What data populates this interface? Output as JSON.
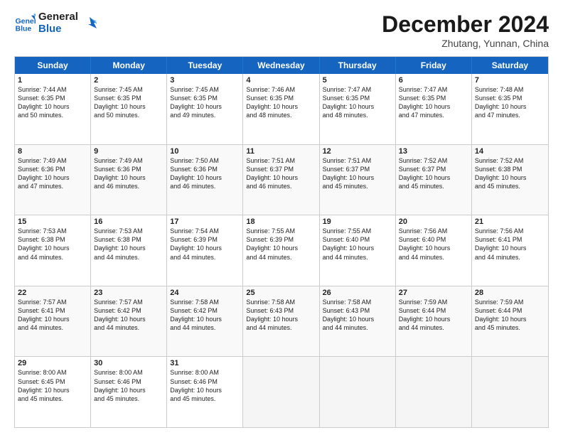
{
  "header": {
    "logo_line1": "General",
    "logo_line2": "Blue",
    "month": "December 2024",
    "location": "Zhutang, Yunnan, China"
  },
  "weekdays": [
    "Sunday",
    "Monday",
    "Tuesday",
    "Wednesday",
    "Thursday",
    "Friday",
    "Saturday"
  ],
  "rows": [
    [
      {
        "day": "1",
        "lines": [
          "Sunrise: 7:44 AM",
          "Sunset: 6:35 PM",
          "Daylight: 10 hours",
          "and 50 minutes."
        ]
      },
      {
        "day": "2",
        "lines": [
          "Sunrise: 7:45 AM",
          "Sunset: 6:35 PM",
          "Daylight: 10 hours",
          "and 50 minutes."
        ]
      },
      {
        "day": "3",
        "lines": [
          "Sunrise: 7:45 AM",
          "Sunset: 6:35 PM",
          "Daylight: 10 hours",
          "and 49 minutes."
        ]
      },
      {
        "day": "4",
        "lines": [
          "Sunrise: 7:46 AM",
          "Sunset: 6:35 PM",
          "Daylight: 10 hours",
          "and 48 minutes."
        ]
      },
      {
        "day": "5",
        "lines": [
          "Sunrise: 7:47 AM",
          "Sunset: 6:35 PM",
          "Daylight: 10 hours",
          "and 48 minutes."
        ]
      },
      {
        "day": "6",
        "lines": [
          "Sunrise: 7:47 AM",
          "Sunset: 6:35 PM",
          "Daylight: 10 hours",
          "and 47 minutes."
        ]
      },
      {
        "day": "7",
        "lines": [
          "Sunrise: 7:48 AM",
          "Sunset: 6:35 PM",
          "Daylight: 10 hours",
          "and 47 minutes."
        ]
      }
    ],
    [
      {
        "day": "8",
        "lines": [
          "Sunrise: 7:49 AM",
          "Sunset: 6:36 PM",
          "Daylight: 10 hours",
          "and 47 minutes."
        ]
      },
      {
        "day": "9",
        "lines": [
          "Sunrise: 7:49 AM",
          "Sunset: 6:36 PM",
          "Daylight: 10 hours",
          "and 46 minutes."
        ]
      },
      {
        "day": "10",
        "lines": [
          "Sunrise: 7:50 AM",
          "Sunset: 6:36 PM",
          "Daylight: 10 hours",
          "and 46 minutes."
        ]
      },
      {
        "day": "11",
        "lines": [
          "Sunrise: 7:51 AM",
          "Sunset: 6:37 PM",
          "Daylight: 10 hours",
          "and 46 minutes."
        ]
      },
      {
        "day": "12",
        "lines": [
          "Sunrise: 7:51 AM",
          "Sunset: 6:37 PM",
          "Daylight: 10 hours",
          "and 45 minutes."
        ]
      },
      {
        "day": "13",
        "lines": [
          "Sunrise: 7:52 AM",
          "Sunset: 6:37 PM",
          "Daylight: 10 hours",
          "and 45 minutes."
        ]
      },
      {
        "day": "14",
        "lines": [
          "Sunrise: 7:52 AM",
          "Sunset: 6:38 PM",
          "Daylight: 10 hours",
          "and 45 minutes."
        ]
      }
    ],
    [
      {
        "day": "15",
        "lines": [
          "Sunrise: 7:53 AM",
          "Sunset: 6:38 PM",
          "Daylight: 10 hours",
          "and 44 minutes."
        ]
      },
      {
        "day": "16",
        "lines": [
          "Sunrise: 7:53 AM",
          "Sunset: 6:38 PM",
          "Daylight: 10 hours",
          "and 44 minutes."
        ]
      },
      {
        "day": "17",
        "lines": [
          "Sunrise: 7:54 AM",
          "Sunset: 6:39 PM",
          "Daylight: 10 hours",
          "and 44 minutes."
        ]
      },
      {
        "day": "18",
        "lines": [
          "Sunrise: 7:55 AM",
          "Sunset: 6:39 PM",
          "Daylight: 10 hours",
          "and 44 minutes."
        ]
      },
      {
        "day": "19",
        "lines": [
          "Sunrise: 7:55 AM",
          "Sunset: 6:40 PM",
          "Daylight: 10 hours",
          "and 44 minutes."
        ]
      },
      {
        "day": "20",
        "lines": [
          "Sunrise: 7:56 AM",
          "Sunset: 6:40 PM",
          "Daylight: 10 hours",
          "and 44 minutes."
        ]
      },
      {
        "day": "21",
        "lines": [
          "Sunrise: 7:56 AM",
          "Sunset: 6:41 PM",
          "Daylight: 10 hours",
          "and 44 minutes."
        ]
      }
    ],
    [
      {
        "day": "22",
        "lines": [
          "Sunrise: 7:57 AM",
          "Sunset: 6:41 PM",
          "Daylight: 10 hours",
          "and 44 minutes."
        ]
      },
      {
        "day": "23",
        "lines": [
          "Sunrise: 7:57 AM",
          "Sunset: 6:42 PM",
          "Daylight: 10 hours",
          "and 44 minutes."
        ]
      },
      {
        "day": "24",
        "lines": [
          "Sunrise: 7:58 AM",
          "Sunset: 6:42 PM",
          "Daylight: 10 hours",
          "and 44 minutes."
        ]
      },
      {
        "day": "25",
        "lines": [
          "Sunrise: 7:58 AM",
          "Sunset: 6:43 PM",
          "Daylight: 10 hours",
          "and 44 minutes."
        ]
      },
      {
        "day": "26",
        "lines": [
          "Sunrise: 7:58 AM",
          "Sunset: 6:43 PM",
          "Daylight: 10 hours",
          "and 44 minutes."
        ]
      },
      {
        "day": "27",
        "lines": [
          "Sunrise: 7:59 AM",
          "Sunset: 6:44 PM",
          "Daylight: 10 hours",
          "and 44 minutes."
        ]
      },
      {
        "day": "28",
        "lines": [
          "Sunrise: 7:59 AM",
          "Sunset: 6:44 PM",
          "Daylight: 10 hours",
          "and 45 minutes."
        ]
      }
    ],
    [
      {
        "day": "29",
        "lines": [
          "Sunrise: 8:00 AM",
          "Sunset: 6:45 PM",
          "Daylight: 10 hours",
          "and 45 minutes."
        ]
      },
      {
        "day": "30",
        "lines": [
          "Sunrise: 8:00 AM",
          "Sunset: 6:46 PM",
          "Daylight: 10 hours",
          "and 45 minutes."
        ]
      },
      {
        "day": "31",
        "lines": [
          "Sunrise: 8:00 AM",
          "Sunset: 6:46 PM",
          "Daylight: 10 hours",
          "and 45 minutes."
        ]
      },
      {
        "day": "",
        "lines": []
      },
      {
        "day": "",
        "lines": []
      },
      {
        "day": "",
        "lines": []
      },
      {
        "day": "",
        "lines": []
      }
    ]
  ]
}
